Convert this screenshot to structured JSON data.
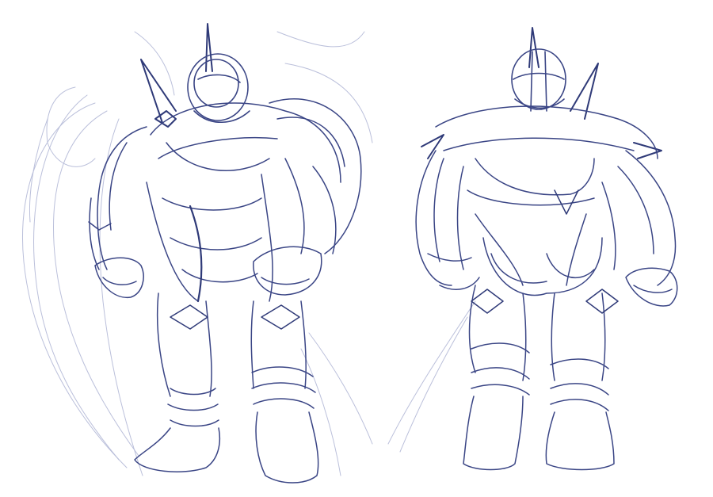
{
  "artwork": {
    "subject": "",
    "colors": {
      "background": "#ffffff",
      "stroke_dark": "#2f3a78",
      "stroke_mid": "#5a64a0",
      "stroke_light": "#aab0d2"
    }
  }
}
